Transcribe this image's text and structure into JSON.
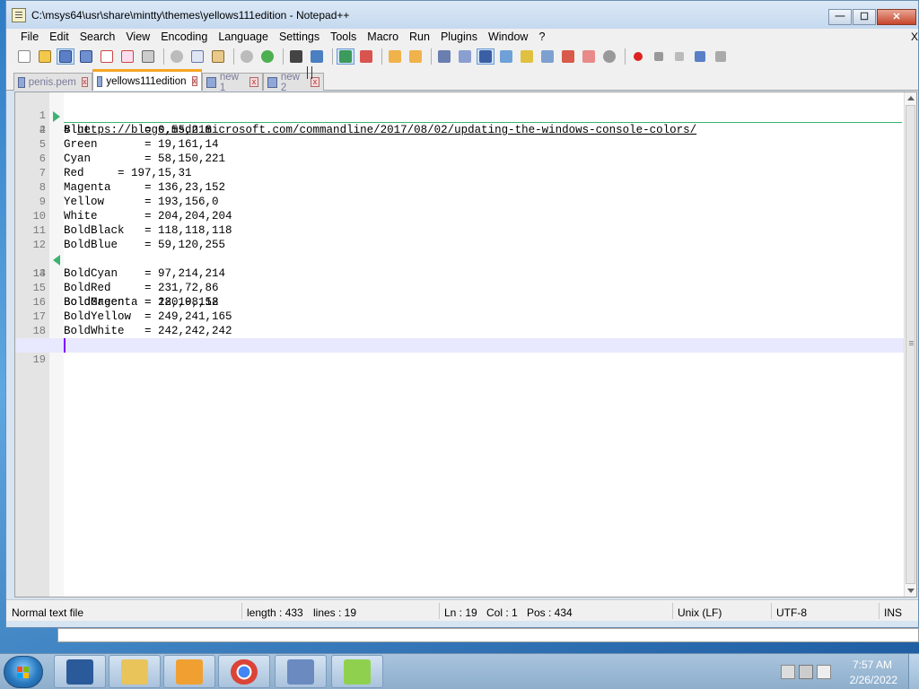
{
  "window": {
    "title": "C:\\msys64\\usr\\share\\mintty\\themes\\yellows111edition - Notepad++",
    "minimize_glyph": "—",
    "maximize_glyph": "☐",
    "close_glyph": "✕"
  },
  "menu": {
    "items": [
      "File",
      "Edit",
      "Search",
      "View",
      "Encoding",
      "Language",
      "Settings",
      "Tools",
      "Macro",
      "Run",
      "Plugins",
      "Window",
      "?"
    ],
    "close_label": "X"
  },
  "toolbar": {
    "icons": [
      "new-file-icon",
      "open-file-icon",
      "save-icon",
      "save-all-icon",
      "close-icon",
      "close-all-icon",
      "print-icon",
      "cut-icon",
      "copy-icon",
      "paste-icon",
      "undo-icon",
      "redo-icon",
      "find-icon",
      "replace-icon",
      "zoom-in-icon",
      "zoom-out-icon",
      "sync-vertical-icon",
      "sync-horizontal-icon",
      "word-wrap-icon",
      "show-all-chars-icon",
      "indent-guide-icon",
      "language-icon",
      "doc-map-icon",
      "function-list-icon",
      "folder-workspace-icon",
      "monitoring-icon",
      "record-macro-icon",
      "stop-record-icon",
      "play-macro-icon",
      "play-multiple-icon",
      "save-macro-icon"
    ]
  },
  "tabs": [
    {
      "label": "penis.pem",
      "active": false
    },
    {
      "label": "yellows111edition",
      "active": true
    },
    {
      "label": "new 1",
      "active": false
    },
    {
      "label": "new 2",
      "active": false
    }
  ],
  "editor": {
    "lines": [
      {
        "n": "1",
        "text": "# https://blogs.msdn.microsoft.com/commandline/2017/08/02/updating-the-windows-console-colors/",
        "url": "https://blogs.msdn.microsoft.com/commandline/2017/08/02/updating-the-windows-console-colors/"
      },
      {
        "n": "2",
        "text": ""
      },
      {
        "n": "4",
        "text": "Blue        = 0,55,218"
      },
      {
        "n": "5",
        "text": "Green       = 19,161,14"
      },
      {
        "n": "6",
        "text": "Cyan        = 58,150,221"
      },
      {
        "n": "7",
        "text": "Red     = 197,15,31"
      },
      {
        "n": "8",
        "text": "Magenta     = 136,23,152"
      },
      {
        "n": "9",
        "text": "Yellow      = 193,156,0"
      },
      {
        "n": "10",
        "text": "White       = 204,204,204"
      },
      {
        "n": "11",
        "text": "BoldBlack   = 118,118,118"
      },
      {
        "n": "12",
        "text": "BoldBlue    = 59,120,255"
      },
      {
        "n": "13",
        "text": "BoldGreen   = 22,198,12"
      },
      {
        "n": "14",
        "text": "BoldCyan    = 97,214,214"
      },
      {
        "n": "15",
        "text": "BoldRed     = 231,72,86"
      },
      {
        "n": "16",
        "text": "BoldMagenta = 180,0,158"
      },
      {
        "n": "17",
        "text": "BoldYellow  = 249,241,165"
      },
      {
        "n": "18",
        "text": "BoldWhite   = 242,242,242"
      },
      {
        "n": "19",
        "text": ""
      }
    ]
  },
  "status": {
    "file_type": "Normal text file",
    "length": "length : 433",
    "lines": "lines : 19",
    "ln": "Ln : 19",
    "col": "Col : 1",
    "pos": "Pos : 434",
    "eol": "Unix (LF)",
    "encoding": "UTF-8",
    "mode": "INS"
  },
  "taskbar": {
    "apps": [
      "msys2-icon",
      "file-explorer-icon",
      "media-player-icon",
      "chrome-icon",
      "keyboard-settings-icon",
      "notepad-plus-plus-icon"
    ],
    "tray_icons": [
      "action-center-icon",
      "network-icon",
      "volume-icon"
    ],
    "time": "7:57 AM",
    "date": "2/26/2022"
  },
  "colors": {
    "accent_tab": "#f5a623",
    "caret": "#8000ff",
    "change_marker": "#3cb371",
    "current_line": "#e8e8ff"
  }
}
